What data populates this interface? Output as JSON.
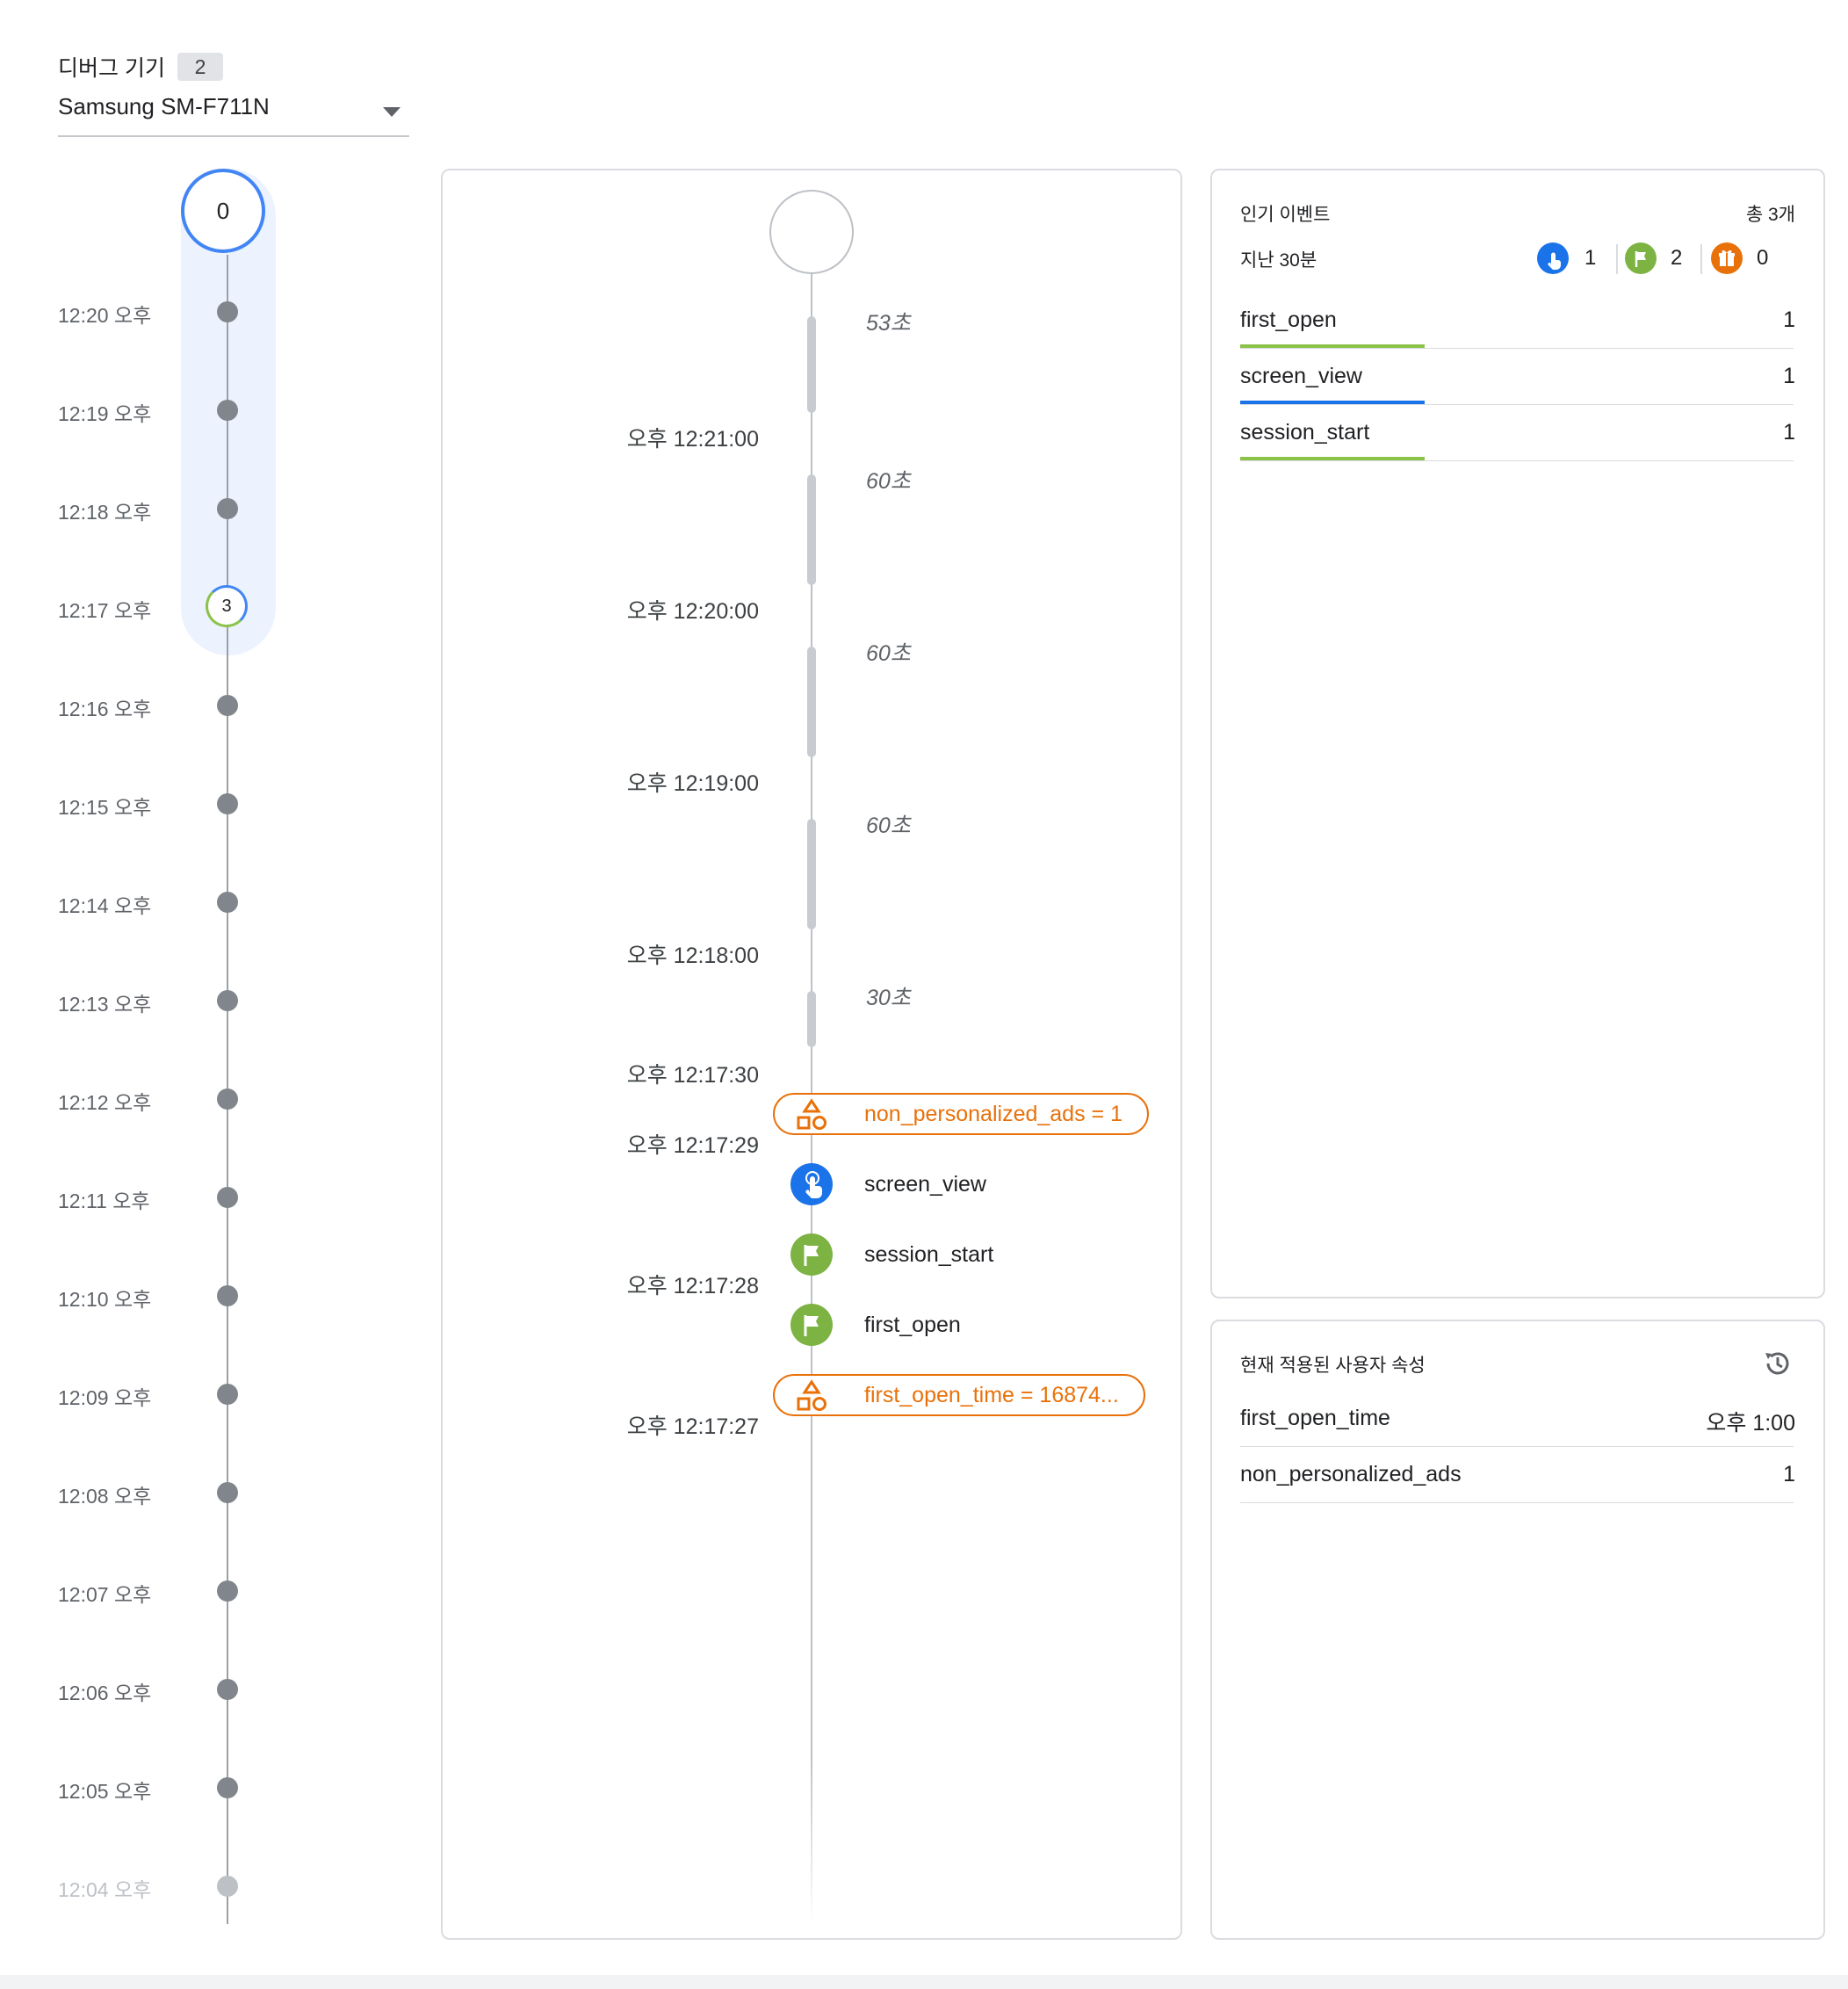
{
  "device": {
    "label": "디버그 기기",
    "count": "2",
    "selected": "Samsung SM-F711N"
  },
  "minutes": {
    "top_count": "0",
    "event_count": "3",
    "items": [
      "12:20 오후",
      "12:19 오후",
      "12:18 오후",
      "12:17 오후",
      "12:16 오후",
      "12:15 오후",
      "12:14 오후",
      "12:13 오후",
      "12:12 오후",
      "12:11 오후",
      "12:10 오후",
      "12:09 오후",
      "12:08 오후",
      "12:07 오후",
      "12:06 오후",
      "12:05 오후",
      "12:04 오후"
    ]
  },
  "seconds_stream": {
    "durations": [
      "53초",
      "60초",
      "60초",
      "60초",
      "30초"
    ],
    "times": [
      "오후 12:21:00",
      "오후 12:20:00",
      "오후 12:19:00",
      "오후 12:18:00",
      "오후 12:17:30",
      "오후 12:17:29",
      "오후 12:17:28",
      "오후 12:17:27"
    ],
    "user_props": [
      {
        "text": "non_personalized_ads = 1",
        "icon": "shapes-icon"
      },
      {
        "text": "first_open_time = 16874...",
        "icon": "shapes-icon"
      }
    ],
    "events": [
      {
        "name": "screen_view",
        "icon": "touch-icon",
        "color": "#1a73e8"
      },
      {
        "name": "session_start",
        "icon": "flag-icon",
        "color": "#7cb342"
      },
      {
        "name": "first_open",
        "icon": "flag-icon",
        "color": "#7cb342"
      }
    ]
  },
  "top_events": {
    "title": "인기 이벤트",
    "total": "총 3개",
    "period": "지난 30분",
    "summary": [
      {
        "icon": "touch-icon",
        "color": "#1a73e8",
        "count": "1"
      },
      {
        "icon": "flag-icon",
        "color": "#7cb342",
        "count": "2"
      },
      {
        "icon": "gift-icon",
        "color": "#e8710a",
        "count": "0"
      }
    ],
    "rows": [
      {
        "name": "first_open",
        "count": "1",
        "color": "#8bc34a"
      },
      {
        "name": "screen_view",
        "count": "1",
        "color": "#1a73e8"
      },
      {
        "name": "session_start",
        "count": "1",
        "color": "#8bc34a"
      }
    ]
  },
  "user_properties": {
    "title": "현재 적용된 사용자 속성",
    "icon": "history-icon",
    "rows": [
      {
        "name": "first_open_time",
        "value": "오후 1:00"
      },
      {
        "name": "non_personalized_ads",
        "value": "1"
      }
    ]
  }
}
